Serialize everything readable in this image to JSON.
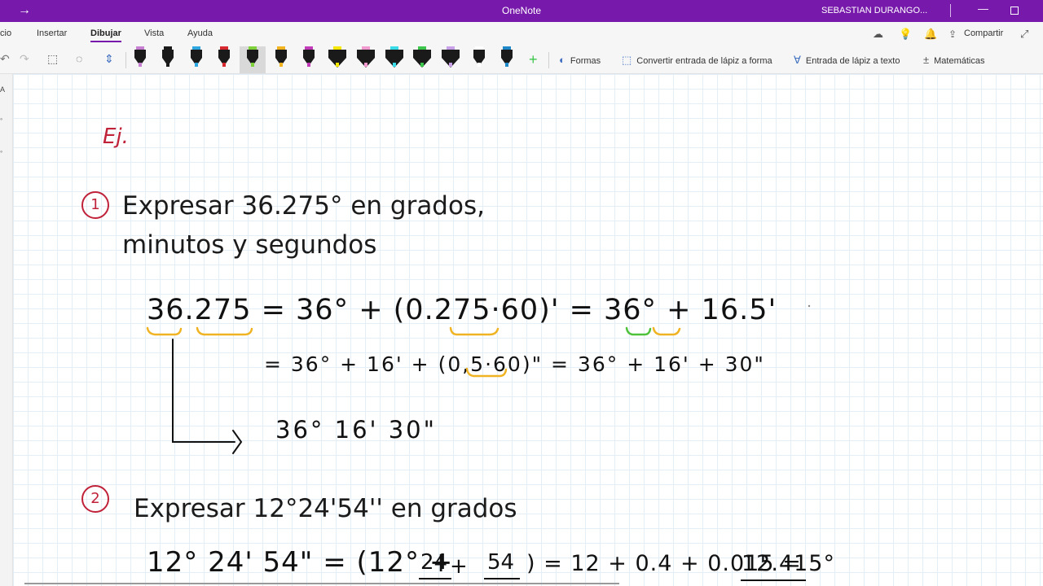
{
  "window": {
    "title": "OneNote",
    "user": "SEBASTIAN DURANGO...",
    "back_glyph": "→",
    "minimize_glyph": "—"
  },
  "ribbon": {
    "tabs": [
      {
        "label": "cio"
      },
      {
        "label": "Insertar"
      },
      {
        "label": "Dibujar",
        "active": true
      },
      {
        "label": "Vista"
      },
      {
        "label": "Ayuda"
      }
    ],
    "share_label": "Compartir"
  },
  "toolbar": {
    "pens": [
      {
        "body": "#1a1a1a",
        "cap": "#c77fd1"
      },
      {
        "body": "#1a1a1a",
        "cap": "#1a1a1a"
      },
      {
        "body": "#1a1a1a",
        "cap": "#2ea6e0"
      },
      {
        "body": "#1a1a1a",
        "cap": "#d7282f"
      },
      {
        "body": "#1a1a1a",
        "cap": "#7fd13b",
        "selected": true
      },
      {
        "body": "#1a1a1a",
        "cap": "#f2b320"
      },
      {
        "body": "#1a1a1a",
        "cap": "#c23bb9"
      },
      {
        "body": "#1a1a1a",
        "cap": "#f5e700",
        "highlighter": true
      },
      {
        "body": "#1a1a1a",
        "cap": "#f29ad0",
        "highlighter": true
      },
      {
        "body": "#1a1a1a",
        "cap": "#38dce8",
        "highlighter": true
      },
      {
        "body": "#1a1a1a",
        "cap": "#3cc64b",
        "highlighter": true
      },
      {
        "body": "#1a1a1a",
        "cap": "#c7a0e8",
        "highlighter": true
      },
      {
        "body": "#1a1a1a",
        "cap": "#ffffff"
      },
      {
        "body": "#1a1a1a",
        "cap": "#1e88c8"
      }
    ],
    "tools": {
      "shapes": "Formas",
      "ink_to_shape": "Convertir entrada de lápiz a forma",
      "ink_to_text": "Entrada de lápiz a texto",
      "math": "Matemáticas"
    }
  },
  "colors": {
    "accent": "#7719aa",
    "circle_red": "#c0223a",
    "underline_yellow": "#f0b323",
    "underline_green": "#4fc23b"
  },
  "page": {
    "ej_label": "Ej.",
    "problem1": {
      "number": "1",
      "line1": "Expresar 36.275° en grados,",
      "line2": "minutos y segundos"
    },
    "work1": {
      "eq1": "36.275 = 36° + (0.275·60)' = 36° + 16.5'",
      "eq2": "= 36° + 16' + (0,5·60)\" = 36° + 16' + 30\"",
      "result": "36° 16' 30\""
    },
    "problem2": {
      "number": "2",
      "line1": "Expresar 12°24'54'' en grados"
    },
    "work2": {
      "eq1_left": "12° 24' 54\" = (12° +",
      "frac1": "24",
      "frac2": "54",
      "eq1_right": ") = 12 + 0.4 + 0.015 =",
      "answer": "12.415°"
    }
  }
}
